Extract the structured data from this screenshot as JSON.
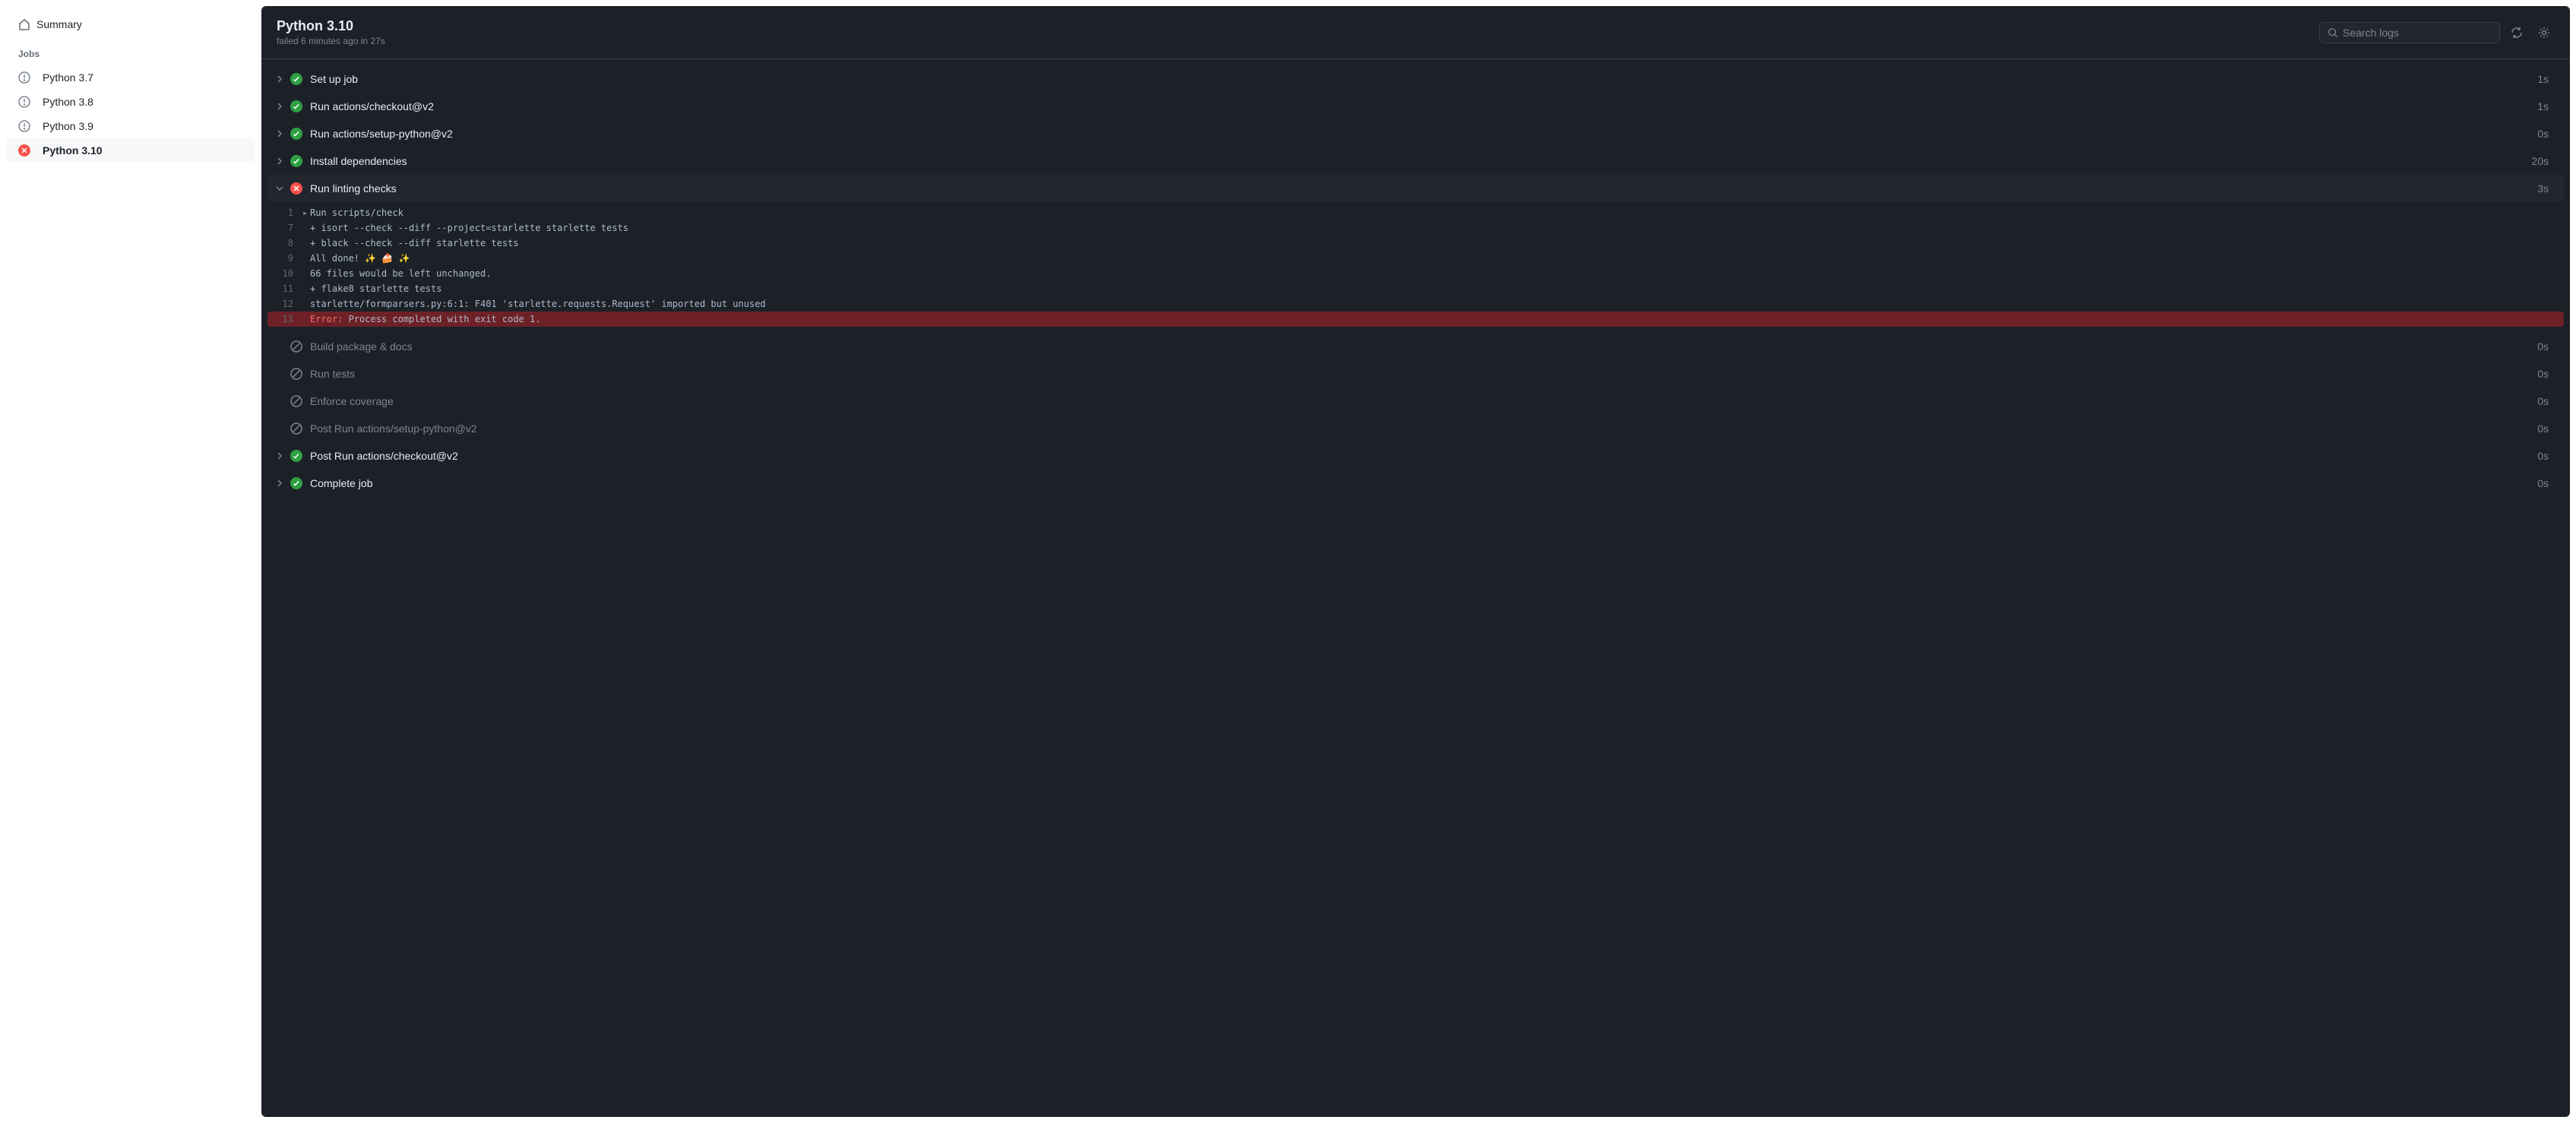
{
  "sidebar": {
    "summary_label": "Summary",
    "jobs_heading": "Jobs",
    "jobs": [
      {
        "label": "Python 3.7",
        "status": "cancelled"
      },
      {
        "label": "Python 3.8",
        "status": "cancelled"
      },
      {
        "label": "Python 3.9",
        "status": "cancelled"
      },
      {
        "label": "Python 3.10",
        "status": "failed",
        "active": true
      }
    ]
  },
  "header": {
    "title": "Python 3.10",
    "status_prefix": "failed",
    "timestamp": "6 minutes ago",
    "in_word": "in",
    "duration": "27s",
    "search_placeholder": "Search logs"
  },
  "steps": [
    {
      "name": "Set up job",
      "status": "success",
      "duration": "1s",
      "collapsible": true
    },
    {
      "name": "Run actions/checkout@v2",
      "status": "success",
      "duration": "1s",
      "collapsible": true
    },
    {
      "name": "Run actions/setup-python@v2",
      "status": "success",
      "duration": "0s",
      "collapsible": true
    },
    {
      "name": "Install dependencies",
      "status": "success",
      "duration": "20s",
      "collapsible": true
    },
    {
      "name": "Run linting checks",
      "status": "failed",
      "duration": "3s",
      "collapsible": true,
      "expanded": true
    },
    {
      "name": "Build package & docs",
      "status": "skipped",
      "duration": "0s",
      "collapsible": false
    },
    {
      "name": "Run tests",
      "status": "skipped",
      "duration": "0s",
      "collapsible": false
    },
    {
      "name": "Enforce coverage",
      "status": "skipped",
      "duration": "0s",
      "collapsible": false
    },
    {
      "name": "Post Run actions/setup-python@v2",
      "status": "skipped",
      "duration": "0s",
      "collapsible": false
    },
    {
      "name": "Post Run actions/checkout@v2",
      "status": "success",
      "duration": "0s",
      "collapsible": true
    },
    {
      "name": "Complete job",
      "status": "success",
      "duration": "0s",
      "collapsible": true
    }
  ],
  "log": {
    "lines": [
      {
        "n": "1",
        "gutter": "▸",
        "text": "Run scripts/check"
      },
      {
        "n": "7",
        "gutter": "",
        "text": "+ isort --check --diff --project=starlette starlette tests"
      },
      {
        "n": "8",
        "gutter": "",
        "text": "+ black --check --diff starlette tests"
      },
      {
        "n": "9",
        "gutter": "",
        "text": "All done! ✨ 🍰 ✨"
      },
      {
        "n": "10",
        "gutter": "",
        "text": "66 files would be left unchanged."
      },
      {
        "n": "11",
        "gutter": "",
        "text": "+ flake8 starlette tests"
      },
      {
        "n": "12",
        "gutter": "",
        "text": "starlette/formparsers.py:6:1: F401 'starlette.requests.Request' imported but unused"
      },
      {
        "n": "13",
        "gutter": "",
        "error": true,
        "err_label": "Error:",
        "text": " Process completed with exit code 1."
      }
    ]
  }
}
